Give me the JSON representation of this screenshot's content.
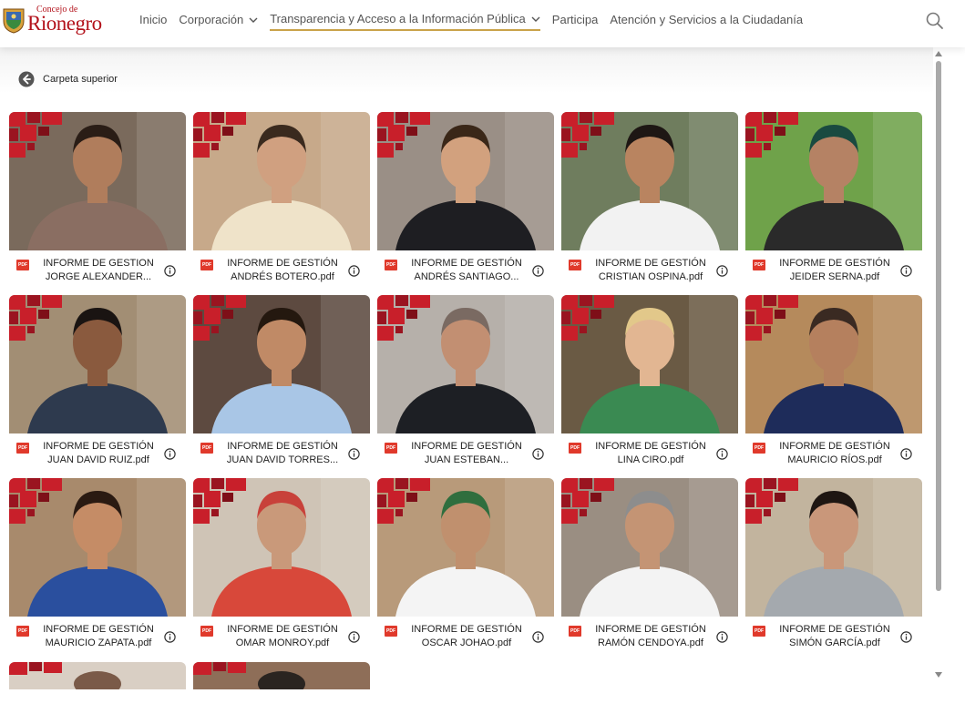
{
  "header": {
    "logo_small": "Concejo de",
    "logo_big": "Rionegro",
    "nav": [
      {
        "label": "Inicio",
        "dropdown": false,
        "active": false
      },
      {
        "label": "Corporación",
        "dropdown": true,
        "active": false
      },
      {
        "label": "Transparencia y Acceso a la Información Pública",
        "dropdown": true,
        "active": true
      },
      {
        "label": "Participa",
        "dropdown": false,
        "active": false
      },
      {
        "label": "Atención y Servicios a la Ciudadanía",
        "dropdown": false,
        "active": false
      }
    ],
    "search_icon": "search-icon"
  },
  "back": {
    "label": "Carpeta superior",
    "icon": "arrow-left-circle-icon"
  },
  "files": [
    {
      "line1": "INFORME DE GESTION",
      "line2": "JORGE ALEXANDER...",
      "bg": "#7a6a5c",
      "shirt": "#8a6e62",
      "skin": "#b07d5c",
      "hair": "#2a1d16"
    },
    {
      "line1": "INFORME DE GESTIÓN",
      "line2": "ANDRÉS BOTERO.pdf",
      "bg": "#c7a98a",
      "shirt": "#efe3c9",
      "skin": "#d0a080",
      "hair": "#3a2a1e"
    },
    {
      "line1": "INFORME DE GESTIÓN",
      "line2": "ANDRÉS SANTIAGO...",
      "bg": "#9a8f86",
      "shirt": "#1e1e22",
      "skin": "#d2a17e",
      "hair": "#3a2718"
    },
    {
      "line1": "INFORME DE GESTIÓN",
      "line2": "CRISTIAN OSPINA.pdf",
      "bg": "#6f7d5e",
      "shirt": "#f2f2f2",
      "skin": "#b98460",
      "hair": "#1e1714"
    },
    {
      "line1": "INFORME DE GESTIÓN",
      "line2": "JEIDER SERNA.pdf",
      "bg": "#6fa24a",
      "shirt": "#2a2a2a",
      "skin": "#b58264",
      "hair": "#1a4a40"
    },
    {
      "line1": "INFORME DE GESTIÓN",
      "line2": "JUAN DAVID RUIZ.pdf",
      "bg": "#a28e74",
      "shirt": "#2e3a4e",
      "skin": "#8a5a3e",
      "hair": "#1a1412"
    },
    {
      "line1": "INFORME DE GESTIÓN",
      "line2": "JUAN DAVID TORRES...",
      "bg": "#5d4a40",
      "shirt": "#a9c6e6",
      "skin": "#c08a66",
      "hair": "#24180f"
    },
    {
      "line1": "INFORME DE GESTIÓN",
      "line2": "JUAN ESTEBAN...",
      "bg": "#b6b0aa",
      "shirt": "#1d1f24",
      "skin": "#c28f72",
      "hair": "#7a6a62"
    },
    {
      "line1": "INFORME DE GESTIÓN",
      "line2": "LINA CIRO.pdf",
      "bg": "#6a5a44",
      "shirt": "#3a8a52",
      "skin": "#e2b692",
      "hair": "#e2c88a"
    },
    {
      "line1": "INFORME DE GESTIÓN",
      "line2": "MAURICIO RÍOS.pdf",
      "bg": "#b58a5c",
      "shirt": "#1e2c5a",
      "skin": "#b5805e",
      "hair": "#3a2a22"
    },
    {
      "line1": "INFORME DE GESTIÓN",
      "line2": "MAURICIO ZAPATA.pdf",
      "bg": "#a88a6c",
      "shirt": "#2a4f9e",
      "skin": "#c58c66",
      "hair": "#2a1a12"
    },
    {
      "line1": "INFORME DE GESTIÓN",
      "line2": "OMAR MONROY.pdf",
      "bg": "#cfc4b6",
      "shirt": "#d8483a",
      "skin": "#c9997a",
      "hair": "#c8413a"
    },
    {
      "line1": "INFORME DE GESTIÓN",
      "line2": "OSCAR JOHAO.pdf",
      "bg": "#b89a7a",
      "shirt": "#f4f4f4",
      "skin": "#c0906e",
      "hair": "#2f6e3e"
    },
    {
      "line1": "INFORME DE GESTIÓN",
      "line2": "RAMÓN CENDOYA.pdf",
      "bg": "#9a8e82",
      "shirt": "#f3f3f3",
      "skin": "#c49474",
      "hair": "#8d8d8d"
    },
    {
      "line1": "INFORME DE GESTIÓN",
      "line2": "SIMÓN GARCÍA.pdf",
      "bg": "#c2b49e",
      "shirt": "#a4a9ae",
      "skin": "#c9977a",
      "hair": "#1e1612"
    }
  ],
  "colors": {
    "brand_red": "#b3121b",
    "deco_red": "#c81f2a",
    "pdf_red": "#e0392b",
    "nav_underline": "#c9a24a"
  }
}
